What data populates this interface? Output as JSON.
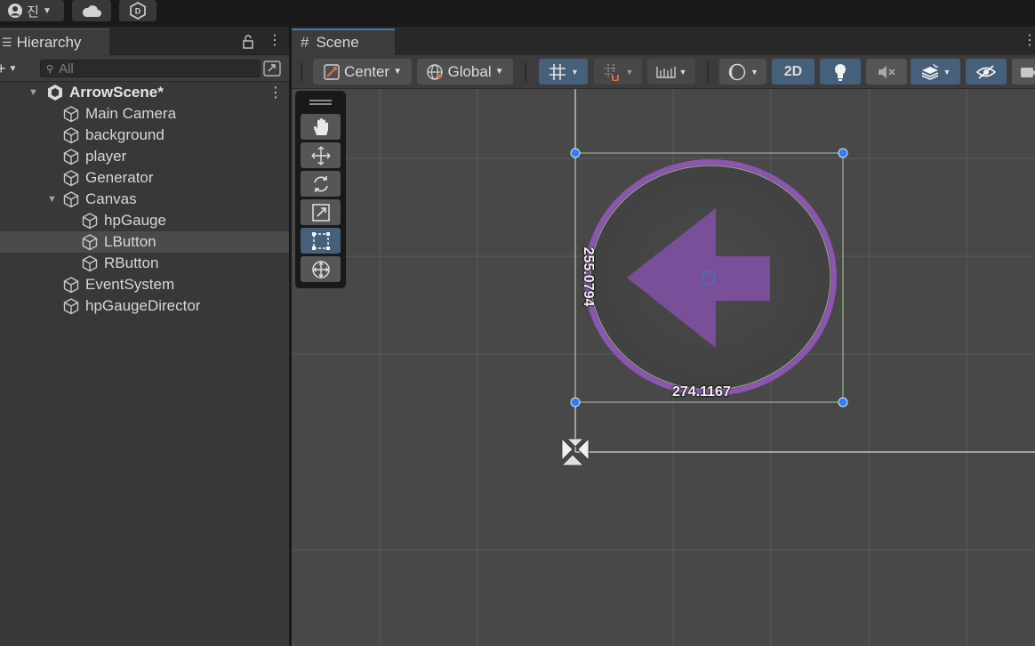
{
  "topbar": {
    "account_label": "진",
    "account_icon": "user-icon",
    "cloud_icon": "cloud-icon",
    "collab_icon": "unity-d-icon"
  },
  "hierarchy": {
    "tab_title": "Hierarchy",
    "search_placeholder": "All",
    "scene_name": "ArrowScene*",
    "items": [
      {
        "label": "Main Camera",
        "depth": 1
      },
      {
        "label": "background",
        "depth": 1
      },
      {
        "label": "player",
        "depth": 1
      },
      {
        "label": "Generator",
        "depth": 1
      },
      {
        "label": "Canvas",
        "depth": 1,
        "expanded": true
      },
      {
        "label": "hpGauge",
        "depth": 2
      },
      {
        "label": "LButton",
        "depth": 2,
        "selected": true
      },
      {
        "label": "RButton",
        "depth": 2
      },
      {
        "label": "EventSystem",
        "depth": 1
      },
      {
        "label": "hpGaugeDirector",
        "depth": 1
      }
    ]
  },
  "scene": {
    "tab_title": "Scene",
    "toolbar": {
      "pivot_label": "Center",
      "space_label": "Global",
      "mode_2d_label": "2D"
    },
    "tools": [
      "hand-tool",
      "move-tool",
      "rotate-tool",
      "scale-tool",
      "rect-tool",
      "transform-tool"
    ],
    "active_tool": "rect-tool",
    "rect_height_label": "255.0794",
    "rect_width_label": "274.1167"
  },
  "colors": {
    "accent": "#46607c",
    "arrow": "#7a4f9a",
    "handle": "#2f80ed"
  }
}
